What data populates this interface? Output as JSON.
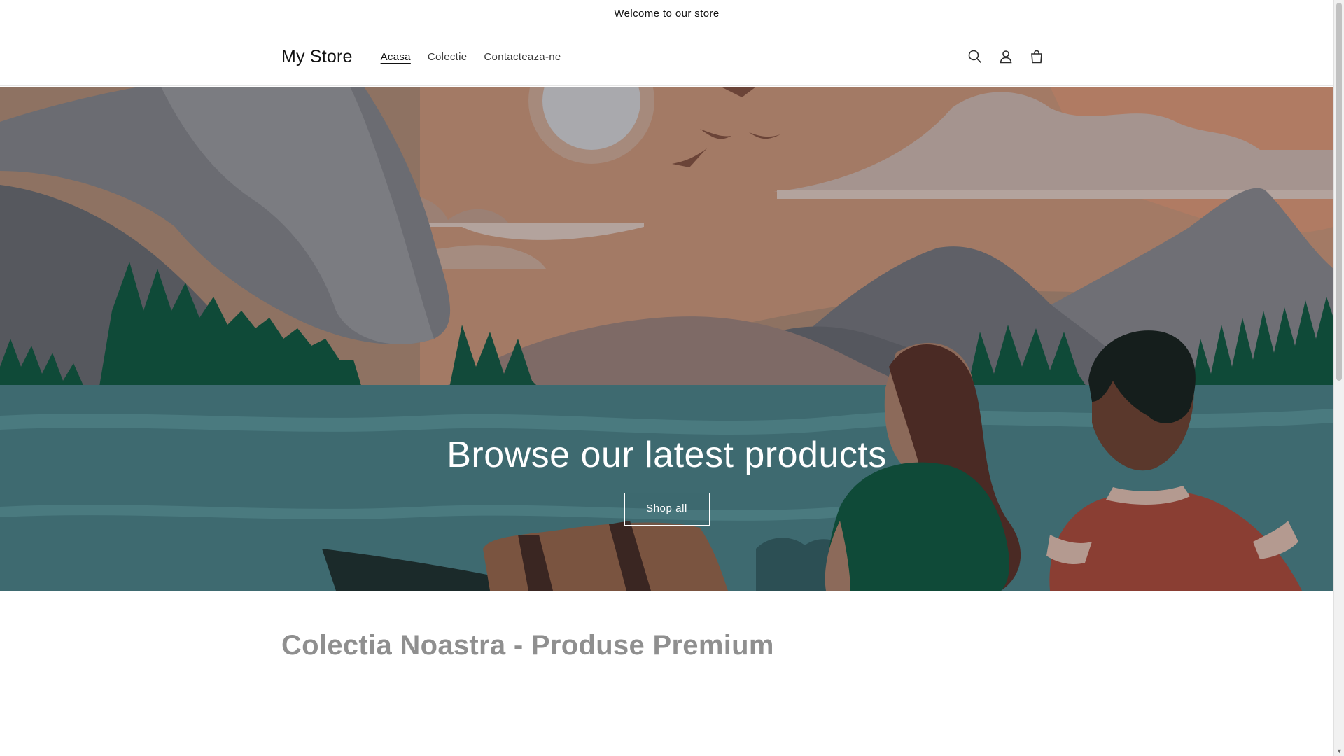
{
  "announcement": {
    "text": "Welcome to our store"
  },
  "header": {
    "logo": "My Store",
    "nav": [
      {
        "label": "Acasa",
        "active": true
      },
      {
        "label": "Colectie",
        "active": false
      },
      {
        "label": "Contacteaza-ne",
        "active": false
      }
    ],
    "icons": [
      "search-icon",
      "account-icon",
      "cart-icon"
    ]
  },
  "hero": {
    "title": "Browse our latest products",
    "button_label": "Shop all"
  },
  "section": {
    "title": "Colectia Noastra - Produse Premium"
  },
  "colors": {
    "sky": "#8e7060",
    "water": "#3e6a70",
    "forest": "#0f4f3c",
    "mountain": "#6a6b70",
    "title_gray": "#8f8f8f"
  }
}
